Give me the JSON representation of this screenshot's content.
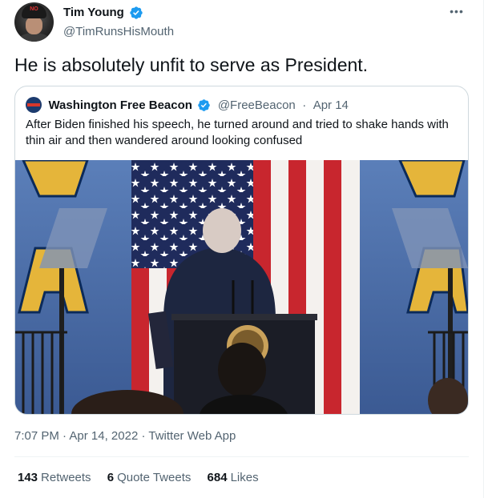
{
  "author": {
    "display_name": "Tim Young",
    "handle": "@TimRunsHisMouth",
    "avatar_hat_text": "NO",
    "verified": true
  },
  "tweet": {
    "text": "He is absolutely unfit to serve as President."
  },
  "quoted": {
    "display_name": "Washington Free Beacon",
    "handle": "@FreeBeacon",
    "separator": "·",
    "date": "Apr 14",
    "text": "After Biden finished his speech, he turned around and tried to shake hands with thin air and then wandered around looking confused",
    "verified": true
  },
  "meta": {
    "time": "7:07 PM",
    "separator": "·",
    "date": "Apr 14, 2022",
    "source": "Twitter Web App"
  },
  "stats": {
    "retweets_count": "143",
    "retweets_label": "Retweets",
    "quotes_count": "6",
    "quotes_label": "Quote Tweets",
    "likes_count": "684",
    "likes_label": "Likes"
  },
  "icons": {
    "more": "more-icon",
    "verified": "verified-badge-icon"
  },
  "colors": {
    "verified_blue": "#1d9bf0",
    "secondary_text": "#536471",
    "border": "#cfd9de"
  }
}
